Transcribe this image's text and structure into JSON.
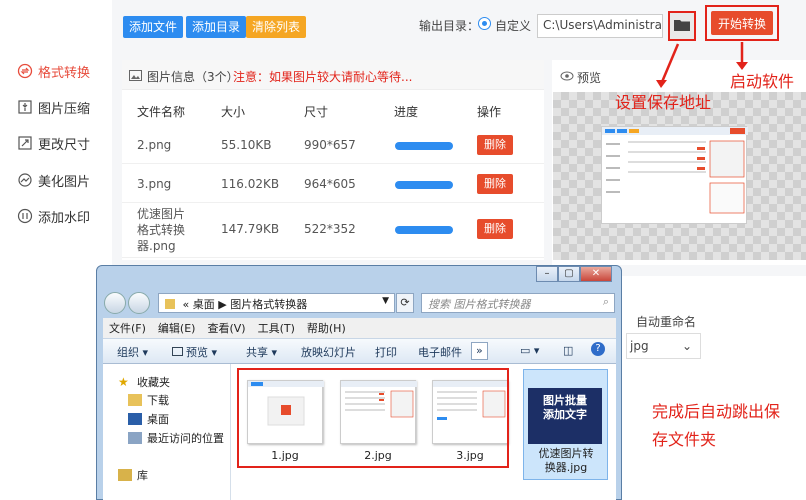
{
  "sidebar": {
    "items": [
      {
        "label": "格式转换",
        "icon": "convert-icon",
        "active": true
      },
      {
        "label": "图片压缩",
        "icon": "compress-icon"
      },
      {
        "label": "更改尺寸",
        "icon": "resize-icon"
      },
      {
        "label": "美化图片",
        "icon": "beautify-icon"
      },
      {
        "label": "添加水印",
        "icon": "watermark-icon"
      }
    ]
  },
  "toolbar": {
    "add_file": "添加文件",
    "add_dir": "添加目录",
    "clear_list": "清除列表",
    "output_label": "输出目录：",
    "radio_label": "自定义",
    "output_path": "C:\\Users\\Administrator\\",
    "start_button": "开始转换"
  },
  "info": {
    "title": "图片信息（3个）",
    "warning": "注意：如果图片较大请耐心等待...",
    "headers": [
      "文件名称",
      "大小",
      "尺寸",
      "进度",
      "操作"
    ],
    "rows": [
      {
        "name": "2.png",
        "size": "55.10KB",
        "dims": "990*657",
        "progress": 1.0,
        "action": "删除"
      },
      {
        "name": "3.png",
        "size": "116.02KB",
        "dims": "964*605",
        "progress": 1.0,
        "action": "删除"
      },
      {
        "name_lines": [
          "优速图片",
          "格式转换",
          "器.png"
        ],
        "size": "147.79KB",
        "dims": "522*352",
        "progress": 1.0,
        "action": "删除"
      }
    ]
  },
  "preview": {
    "label": "预览"
  },
  "annotations": {
    "save_path": "设置保存地址",
    "start": "启动软件",
    "auto_open_1": "完成后自动跳出保",
    "auto_open_2": "存文件夹"
  },
  "rename": {
    "label": "自动重命名",
    "value": "jpg"
  },
  "explorer": {
    "breadcrumb": [
      "«",
      "桌面",
      "▶",
      "图片格式转换器"
    ],
    "search_placeholder": "搜索 图片格式转换器",
    "menu": [
      "文件(F)",
      "编辑(E)",
      "查看(V)",
      "工具(T)",
      "帮助(H)"
    ],
    "commands": [
      "组织 ▾",
      "预览 ▾",
      "共享 ▾",
      "放映幻灯片",
      "打印",
      "电子邮件",
      "»"
    ],
    "nav": [
      "收藏夹",
      "下载",
      "桌面",
      "最近访问的位置",
      "库"
    ],
    "files": [
      "1.jpg",
      "2.jpg",
      "3.jpg"
    ],
    "selected_file_lines": [
      "优速图片转",
      "换器.jpg"
    ],
    "selected_thumb_lines": [
      "图片批量",
      "添加文字"
    ]
  },
  "colors": {
    "accent": "#2d8cf0",
    "danger": "#e74c2c",
    "annotation": "#e2231a"
  }
}
